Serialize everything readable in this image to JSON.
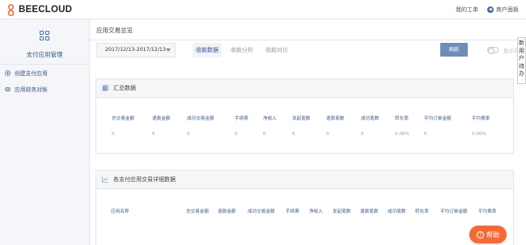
{
  "header": {
    "brand": "BEECLOUD",
    "my_work": "我的工单",
    "merchant_panel": "商户面板"
  },
  "sidebar": {
    "title": "支付应用管理",
    "items": [
      {
        "label": "创建支付应用",
        "icon": "plus-circle-icon"
      },
      {
        "label": "应用财务对账",
        "icon": "coins-icon"
      }
    ]
  },
  "main": {
    "page_title": "应用交易总览",
    "date_range": "2017/12/13-2017/12/13",
    "tabs": [
      {
        "label": "收款数据",
        "active": true
      },
      {
        "label": "收款分析",
        "active": false
      },
      {
        "label": "收款对比",
        "active": false
      }
    ],
    "refresh_label": "刷新",
    "toggle_label": "显示环比"
  },
  "summary": {
    "title": "汇总数据",
    "headers": [
      "总交易金额",
      "退款金额",
      "成功交易金额",
      "手续费",
      "净收入",
      "发起笔数",
      "退款笔数",
      "成功笔数",
      "转化率",
      "平均订单金额",
      "平均费率"
    ],
    "values": [
      "0",
      "0",
      "0",
      "0",
      "0",
      "0",
      "0",
      "0",
      "0.00%",
      "0",
      "0.00%"
    ]
  },
  "detail": {
    "title": "各支付应用交易详细数据",
    "headers": [
      "应用名称",
      "总交易金额",
      "退款金额",
      "成功交易金额",
      "手续费",
      "净收入",
      "发起笔数",
      "退款笔数",
      "成功笔数",
      "转化率",
      "平均订单金额",
      "平均费率"
    ]
  },
  "float_panel": {
    "chars": [
      "新",
      "用",
      "户",
      "待",
      "办"
    ]
  },
  "help": {
    "label": "帮助"
  },
  "colors": {
    "accent": "#3a5a8c",
    "button": "#6f8db9",
    "help": "#f26a36",
    "logo": "#f26a36"
  }
}
